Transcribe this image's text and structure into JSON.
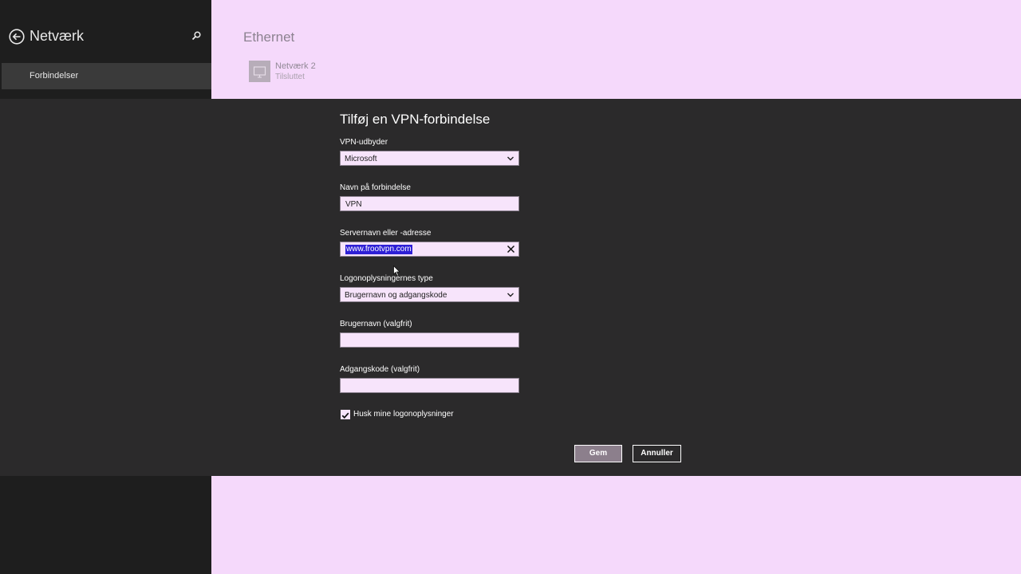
{
  "sidebar": {
    "title": "Netværk",
    "items": [
      {
        "label": "Forbindelser"
      }
    ]
  },
  "main": {
    "title": "Ethernet",
    "network": {
      "name": "Netværk  2",
      "status": "Tilsluttet"
    }
  },
  "dialog": {
    "title": "Tilføj en VPN-forbindelse",
    "provider": {
      "label": "VPN-udbyder",
      "value": "Microsoft"
    },
    "connection_name": {
      "label": "Navn på forbindelse",
      "value": "VPN"
    },
    "server": {
      "label": "Servernavn eller -adresse",
      "value": "www.frootvpn.com"
    },
    "signin_type": {
      "label": "Logonoplysningernes type",
      "value": "Brugernavn og adgangskode"
    },
    "username": {
      "label": "Brugernavn (valgfrit)",
      "value": ""
    },
    "password": {
      "label": "Adgangskode (valgfrit)",
      "value": ""
    },
    "remember": {
      "label": "Husk mine logonoplysninger",
      "checked": true
    },
    "buttons": {
      "save": "Gem",
      "cancel": "Annuller"
    }
  },
  "colors": {
    "accent": "#f5d9fb",
    "dialog_bg": "#2b2a2b",
    "sidebar_bg": "#1e1e1e",
    "selection": "#2e1fd6"
  }
}
